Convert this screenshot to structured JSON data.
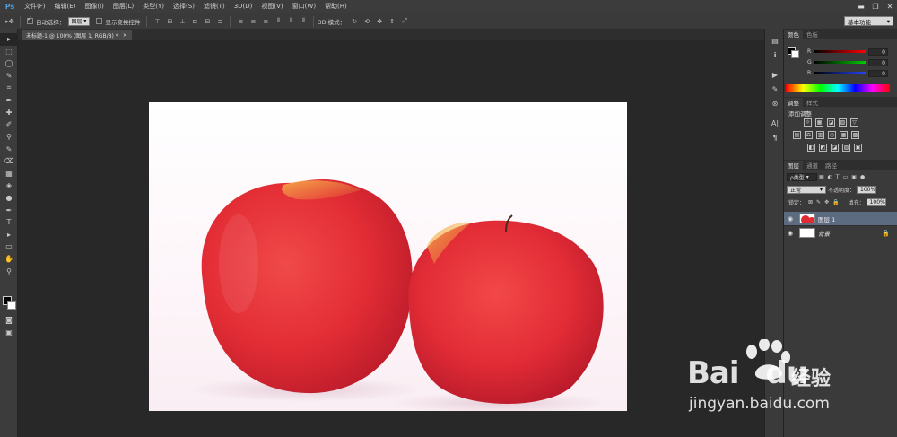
{
  "app": {
    "logo": "Ps"
  },
  "menu": [
    "文件(F)",
    "编辑(E)",
    "图像(I)",
    "图层(L)",
    "类型(Y)",
    "选择(S)",
    "滤镜(T)",
    "3D(D)",
    "视图(V)",
    "窗口(W)",
    "帮助(H)"
  ],
  "window_controls": {
    "minimize": "▬",
    "restore": "❐",
    "close": "✕"
  },
  "options": {
    "auto_select_label": "自动选择：",
    "auto_select_value": "图层",
    "show_transform_label": "显示变换控件",
    "mode_3d_label": "3D 模式：",
    "workspace": "基本功能"
  },
  "document_tab": {
    "title": "未标题-1 @ 100% (图层 1, RGB/8) *",
    "close": "×"
  },
  "tools": [
    "▸",
    "⬚",
    "◯",
    "✎",
    "⌗",
    "✒",
    "✚",
    "✐",
    "⚲",
    "✎",
    "⌫",
    "▦",
    "◈",
    "●",
    "✒",
    "T",
    "▸",
    "▭",
    "✋",
    "⚲"
  ],
  "color_panel": {
    "tabs": [
      "颜色",
      "色板"
    ],
    "channels": [
      {
        "label": "R",
        "value": "0",
        "color": "#e02020"
      },
      {
        "label": "G",
        "value": "0",
        "color": "#20c020"
      },
      {
        "label": "B",
        "value": "0",
        "color": "#2040e0"
      }
    ]
  },
  "adjust_panel": {
    "tabs": [
      "调整",
      "样式"
    ],
    "title": "添加调整",
    "rows": [
      [
        "☼",
        "▦",
        "◪",
        "▨",
        "▽"
      ],
      [
        "▤",
        "⚖",
        "▥",
        "◎",
        "▦",
        "▩"
      ],
      [
        "◧",
        "◩",
        "◪",
        "▧",
        "▣"
      ]
    ]
  },
  "layers_panel": {
    "tabs": [
      "图层",
      "通道",
      "路径"
    ],
    "kind_label": "ρ类型",
    "blend_mode": "正常",
    "opacity_label": "不透明度：",
    "opacity_value": "100%",
    "lock_label": "锁定：",
    "fill_label": "填充：",
    "fill_value": "100%",
    "layers": [
      {
        "name": "图层 1",
        "selected": true
      },
      {
        "name": "背景",
        "selected": false,
        "locked": true
      }
    ]
  },
  "watermark": {
    "brand": "Bai",
    "brand2": "du",
    "cn": "经验",
    "url": "jingyan.baidu.com"
  }
}
